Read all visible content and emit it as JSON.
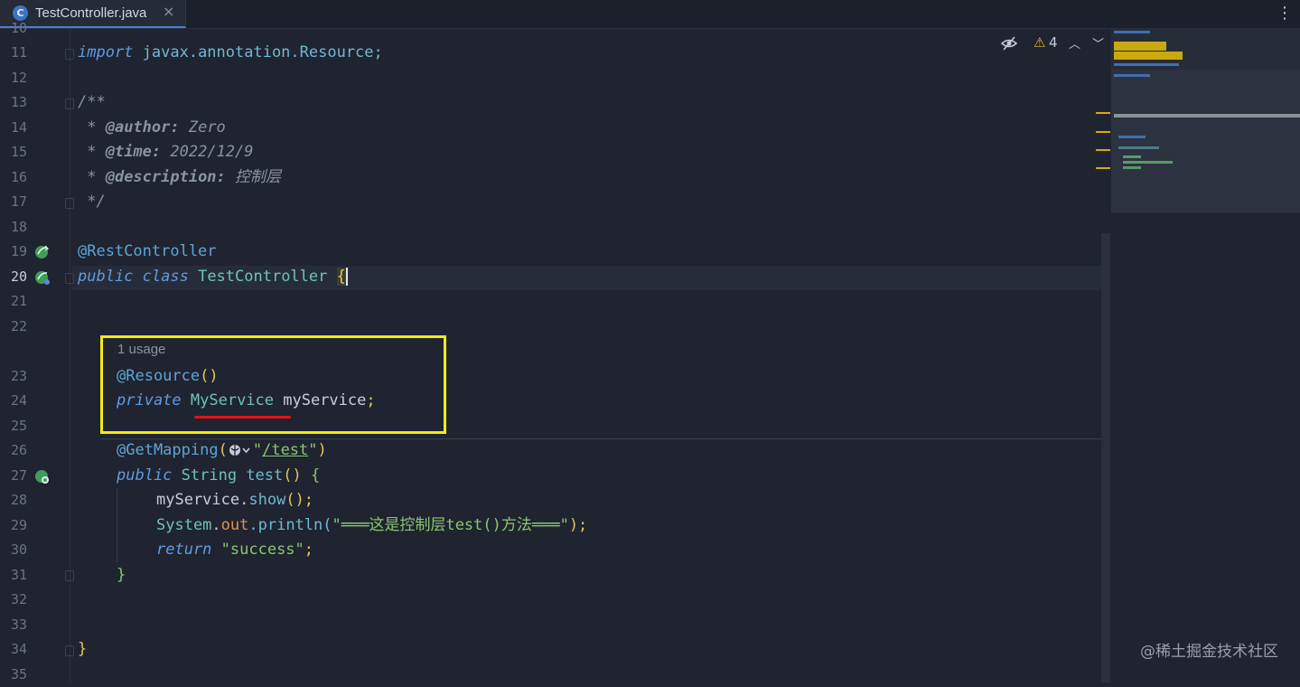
{
  "tab": {
    "label": "TestController.java",
    "icon_letter": "C",
    "close": "×"
  },
  "toolbar": {
    "more": "⋮",
    "warning_count": "4",
    "warning_icon": "⚠",
    "up": "︿",
    "down": "﹀"
  },
  "gutter": {
    "line_numbers": [
      "10",
      "11",
      "12",
      "13",
      "14",
      "15",
      "16",
      "17",
      "18",
      "19",
      "20",
      "21",
      "22",
      "23",
      "24",
      "25",
      "26",
      "27",
      "28",
      "29",
      "30",
      "31",
      "32",
      "33",
      "34",
      "35"
    ]
  },
  "code": {
    "import_kw": "import",
    "import_path": " javax.annotation.Resource;",
    "doc_open": "/**",
    "author_prefix": " * ",
    "author_tag": "@author:",
    "author_val": " Zero",
    "time_prefix": " * ",
    "time_tag": "@time:",
    "time_val": " 2022/12/9",
    "desc_prefix": " * ",
    "desc_tag": "@description:",
    "desc_val": " 控制层",
    "doc_close": " */",
    "annotation_rest": "@RestController",
    "public_kw": "public",
    "class_kw": " class",
    "class_name": " TestController ",
    "open_brace": "{",
    "usage_hint": "1 usage",
    "resource_ann": "@Resource",
    "resource_parens": "()",
    "private_kw": "private",
    "service_type": " MyService",
    "service_field": " myService",
    "semicolon": ";",
    "getmapping_ann": "@GetMapping",
    "paren_open": "(",
    "path_str_q1": "\"",
    "path_str": "/test",
    "path_str_q2": "\"",
    "paren_close": ")",
    "public_kw2": "public",
    "string_type": " String",
    "method_name": " test",
    "method_parens": "()",
    "method_brace": " {",
    "call_obj": "myService",
    "call_dot": ".",
    "call_method": "show",
    "call_end": "();",
    "sys_class": "System",
    "sys_dot": ".",
    "sys_out": "out",
    "sys_println": ".println(",
    "println_str": "\"═══这是控制层test()方法═══\"",
    "println_end": ");",
    "return_kw": "return",
    "return_str": " \"success\"",
    "return_end": ";",
    "method_close": "}",
    "class_close": "}"
  },
  "watermark": "@稀土掘金技术社区",
  "colors": {
    "highlight_box": "#f2ec12",
    "underline": "#e01414",
    "background": "#1f2430"
  }
}
